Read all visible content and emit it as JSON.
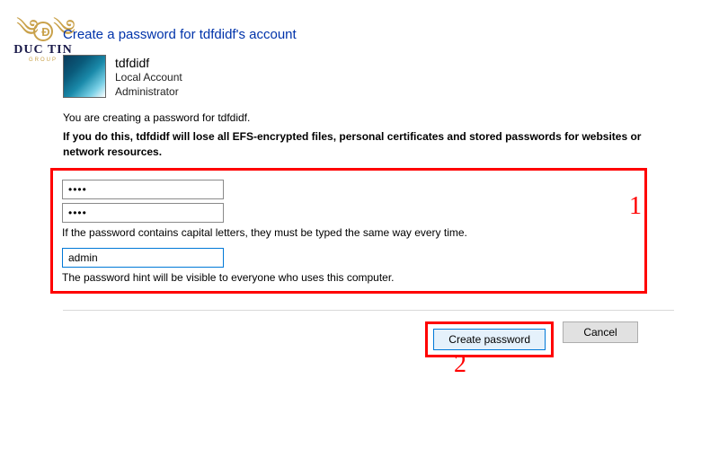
{
  "watermark": {
    "circle_letter": "Đ",
    "brand": "DUC TIN",
    "sub": "GROUP"
  },
  "heading": "Create a password for tdfdidf's account",
  "account": {
    "name": "tdfdidf",
    "type": "Local Account",
    "role": "Administrator"
  },
  "intro": "You are creating a password for tdfdidf.",
  "warning": "If you do this, tdfdidf will lose all EFS-encrypted files, personal certificates and stored passwords for websites or network resources.",
  "form": {
    "password_value": "••••",
    "password_confirm_value": "••••",
    "capital_helper": "If the password contains capital letters, they must be typed the same way every time.",
    "hint_value": "admin",
    "hint_helper": "The password hint will be visible to everyone who uses this computer."
  },
  "annotations": {
    "marker1": "1",
    "marker2": "2"
  },
  "buttons": {
    "create": "Create password",
    "cancel": "Cancel"
  }
}
